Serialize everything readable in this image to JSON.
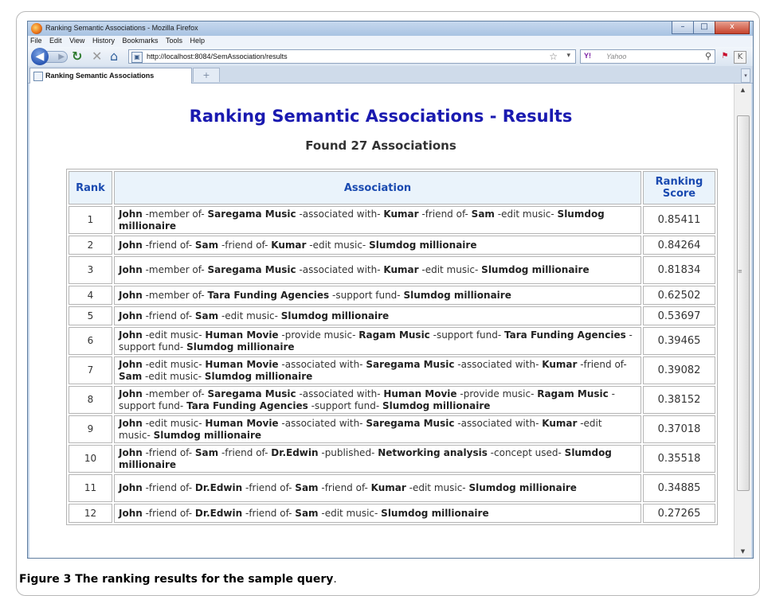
{
  "window": {
    "title": "Ranking Semantic Associations - Mozilla Firefox",
    "buttons": {
      "minimize": "–",
      "maximize": "□",
      "close": "x"
    }
  },
  "menu": [
    "File",
    "Edit",
    "View",
    "History",
    "Bookmarks",
    "Tools",
    "Help"
  ],
  "navbar": {
    "url": "http://localhost:8084/SemAssociation/results",
    "search_engine": "Y!",
    "search_placeholder": "Yahoo"
  },
  "tab": {
    "label": "Ranking Semantic Associations",
    "new_tab": "+"
  },
  "page": {
    "title": "Ranking Semantic Associations - Results",
    "subtitle": "Found 27 Associations",
    "columns": {
      "rank": "Rank",
      "association": "Association",
      "score": "Ranking Score"
    },
    "rows": [
      {
        "rank": "1",
        "score": "0.85411",
        "segments": [
          {
            "t": "John",
            "b": true
          },
          {
            "t": " -member of- ",
            "b": false
          },
          {
            "t": "Saregama Music",
            "b": true
          },
          {
            "t": " -associated with- ",
            "b": false
          },
          {
            "t": "Kumar",
            "b": true
          },
          {
            "t": " -friend of- ",
            "b": false
          },
          {
            "t": "Sam",
            "b": true
          },
          {
            "t": " -edit music- ",
            "b": false
          },
          {
            "t": "Slumdog millionaire",
            "b": true
          }
        ]
      },
      {
        "rank": "2",
        "score": "0.84264",
        "segments": [
          {
            "t": "John",
            "b": true
          },
          {
            "t": " -friend of- ",
            "b": false
          },
          {
            "t": "Sam",
            "b": true
          },
          {
            "t": " -friend of- ",
            "b": false
          },
          {
            "t": "Kumar",
            "b": true
          },
          {
            "t": " -edit music- ",
            "b": false
          },
          {
            "t": "Slumdog millionaire",
            "b": true
          }
        ]
      },
      {
        "rank": "3",
        "score": "0.81834",
        "segments": [
          {
            "t": "John",
            "b": true
          },
          {
            "t": " -member of- ",
            "b": false
          },
          {
            "t": "Saregama Music",
            "b": true
          },
          {
            "t": " -associated with- ",
            "b": false
          },
          {
            "t": "Kumar",
            "b": true
          },
          {
            "t": " -edit music- ",
            "b": false
          },
          {
            "t": "Slumdog millionaire",
            "b": true
          }
        ]
      },
      {
        "rank": "4",
        "score": "0.62502",
        "segments": [
          {
            "t": "John",
            "b": true
          },
          {
            "t": " -member of- ",
            "b": false
          },
          {
            "t": "Tara Funding Agencies",
            "b": true
          },
          {
            "t": " -support fund- ",
            "b": false
          },
          {
            "t": "Slumdog millionaire",
            "b": true
          }
        ]
      },
      {
        "rank": "5",
        "score": "0.53697",
        "segments": [
          {
            "t": "John",
            "b": true
          },
          {
            "t": " -friend of- ",
            "b": false
          },
          {
            "t": "Sam",
            "b": true
          },
          {
            "t": " -edit music- ",
            "b": false
          },
          {
            "t": "Slumdog millionaire",
            "b": true
          }
        ]
      },
      {
        "rank": "6",
        "score": "0.39465",
        "segments": [
          {
            "t": "John",
            "b": true
          },
          {
            "t": " -edit music- ",
            "b": false
          },
          {
            "t": "Human Movie",
            "b": true
          },
          {
            "t": " -provide music- ",
            "b": false
          },
          {
            "t": "Ragam Music",
            "b": true
          },
          {
            "t": " -support fund- ",
            "b": false
          },
          {
            "t": "Tara Funding Agencies",
            "b": true
          },
          {
            "t": " -support fund- ",
            "b": false
          },
          {
            "t": "Slumdog millionaire",
            "b": true
          }
        ]
      },
      {
        "rank": "7",
        "score": "0.39082",
        "segments": [
          {
            "t": "John",
            "b": true
          },
          {
            "t": " -edit music- ",
            "b": false
          },
          {
            "t": "Human Movie",
            "b": true
          },
          {
            "t": " -associated with- ",
            "b": false
          },
          {
            "t": "Saregama Music",
            "b": true
          },
          {
            "t": " -associated with- ",
            "b": false
          },
          {
            "t": "Kumar",
            "b": true
          },
          {
            "t": " -friend of- ",
            "b": false
          },
          {
            "t": "Sam",
            "b": true
          },
          {
            "t": " -edit music- ",
            "b": false
          },
          {
            "t": "Slumdog millionaire",
            "b": true
          }
        ]
      },
      {
        "rank": "8",
        "score": "0.38152",
        "segments": [
          {
            "t": "John",
            "b": true
          },
          {
            "t": " -member of- ",
            "b": false
          },
          {
            "t": "Saregama Music",
            "b": true
          },
          {
            "t": " -associated with- ",
            "b": false
          },
          {
            "t": "Human Movie",
            "b": true
          },
          {
            "t": " -provide music- ",
            "b": false
          },
          {
            "t": "Ragam Music",
            "b": true
          },
          {
            "t": " -support fund- ",
            "b": false
          },
          {
            "t": "Tara Funding Agencies",
            "b": true
          },
          {
            "t": " -support fund- ",
            "b": false
          },
          {
            "t": "Slumdog millionaire",
            "b": true
          }
        ]
      },
      {
        "rank": "9",
        "score": "0.37018",
        "segments": [
          {
            "t": "John",
            "b": true
          },
          {
            "t": " -edit music- ",
            "b": false
          },
          {
            "t": "Human Movie",
            "b": true
          },
          {
            "t": " -associated with- ",
            "b": false
          },
          {
            "t": "Saregama Music",
            "b": true
          },
          {
            "t": " -associated with- ",
            "b": false
          },
          {
            "t": "Kumar",
            "b": true
          },
          {
            "t": " -edit music- ",
            "b": false
          },
          {
            "t": "Slumdog millionaire",
            "b": true
          }
        ]
      },
      {
        "rank": "10",
        "score": "0.35518",
        "segments": [
          {
            "t": "John",
            "b": true
          },
          {
            "t": " -friend of- ",
            "b": false
          },
          {
            "t": "Sam",
            "b": true
          },
          {
            "t": " -friend of- ",
            "b": false
          },
          {
            "t": "Dr.Edwin",
            "b": true
          },
          {
            "t": " -published- ",
            "b": false
          },
          {
            "t": "Networking analysis",
            "b": true
          },
          {
            "t": " -concept used- ",
            "b": false
          },
          {
            "t": "Slumdog millionaire",
            "b": true
          }
        ]
      },
      {
        "rank": "11",
        "score": "0.34885",
        "segments": [
          {
            "t": "John",
            "b": true
          },
          {
            "t": " -friend of- ",
            "b": false
          },
          {
            "t": "Dr.Edwin",
            "b": true
          },
          {
            "t": " -friend of- ",
            "b": false
          },
          {
            "t": "Sam",
            "b": true
          },
          {
            "t": " -friend of- ",
            "b": false
          },
          {
            "t": "Kumar",
            "b": true
          },
          {
            "t": " -edit music- ",
            "b": false
          },
          {
            "t": "Slumdog millionaire",
            "b": true
          }
        ]
      },
      {
        "rank": "12",
        "score": "0.27265",
        "segments": [
          {
            "t": "John",
            "b": true
          },
          {
            "t": " -friend of- ",
            "b": false
          },
          {
            "t": "Dr.Edwin",
            "b": true
          },
          {
            "t": " -friend of- ",
            "b": false
          },
          {
            "t": "Sam",
            "b": true
          },
          {
            "t": " -edit music- ",
            "b": false
          },
          {
            "t": "Slumdog millionaire",
            "b": true
          }
        ]
      }
    ]
  },
  "caption": {
    "label": "Figure 3",
    "text": " The ranking results for the sample query",
    "end": "."
  },
  "icons": {
    "back": "back-arrow-icon",
    "forward": "forward-arrow-icon",
    "reload": "reload-icon",
    "stop": "stop-icon",
    "home": "home-icon",
    "bookmark": "star-icon",
    "search": "magnifier-icon"
  }
}
